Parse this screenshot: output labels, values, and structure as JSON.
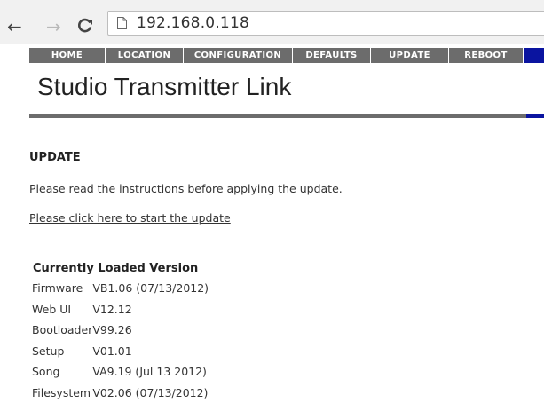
{
  "browser": {
    "url": "192.168.0.118",
    "back_icon": "back-arrow-icon",
    "forward_icon": "forward-arrow-icon",
    "reload_icon": "reload-icon",
    "page_icon": "page-icon"
  },
  "nav": {
    "items": [
      {
        "label": "HOME"
      },
      {
        "label": "LOCATION"
      },
      {
        "label": "CONFIGURATION"
      },
      {
        "label": "DEFAULTS"
      },
      {
        "label": "UPDATE"
      },
      {
        "label": "REBOOT"
      }
    ]
  },
  "colors": {
    "nav_bg": "#6c6c6c",
    "nav_accent": "#0a14a0"
  },
  "site": {
    "title": "Studio Transmitter Link"
  },
  "content": {
    "heading": "UPDATE",
    "instructions": "Please read the instructions before applying the update.",
    "link_text": "Please click here to start the update"
  },
  "versions": {
    "heading": "Currently Loaded Version",
    "rows": [
      {
        "label": "Firmware",
        "value": "VB1.06 (07/13/2012)"
      },
      {
        "label": "Web UI",
        "value": "V12.12"
      },
      {
        "label": "Bootloader",
        "value": "V99.26"
      },
      {
        "label": "Setup",
        "value": "V01.01"
      },
      {
        "label": "Song",
        "value": "VA9.19 (Jul 13 2012)"
      },
      {
        "label": "Filesystem",
        "value": "V02.06 (07/13/2012)"
      }
    ]
  }
}
